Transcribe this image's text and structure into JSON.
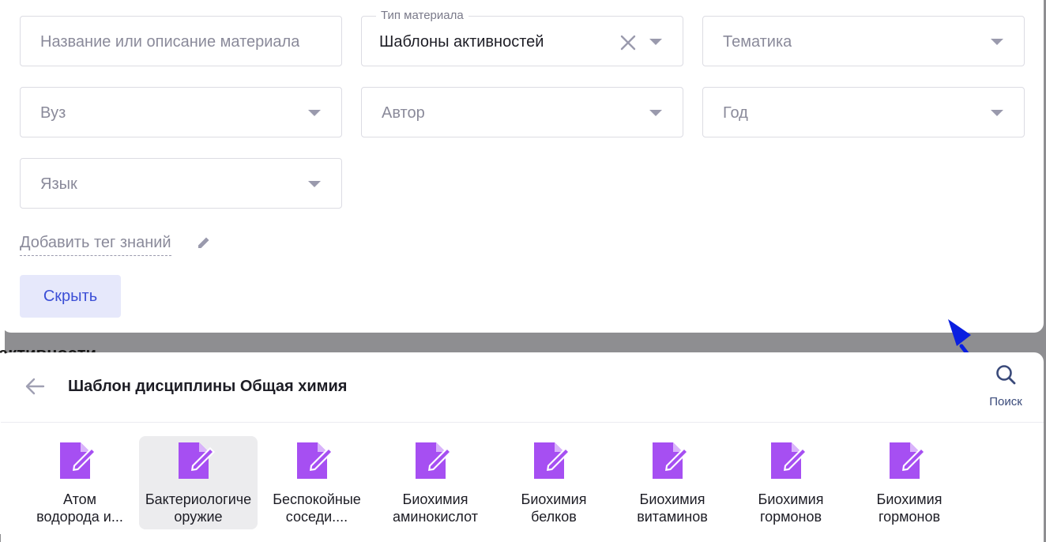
{
  "background": {
    "heading": "активности"
  },
  "filters": {
    "name_placeholder": "Название или описание материала",
    "material_type": {
      "label": "Тип материала",
      "value": "Шаблоны активностей"
    },
    "topic_placeholder": "Тематика",
    "university_placeholder": "Вуз",
    "author_placeholder": "Автор",
    "year_placeholder": "Год",
    "language_placeholder": "Язык",
    "add_tag_label": "Добавить тег знаний",
    "hide_button": "Скрыть"
  },
  "panel": {
    "title": "Шаблон дисциплины Общая химия",
    "search_label": "Поиск",
    "items": [
      {
        "name": "Атом\nводорода и..."
      },
      {
        "name": "Бактериологиче\nоружие",
        "selected": true
      },
      {
        "name": "Беспокойные\nсоседи...."
      },
      {
        "name": "Биохимия\nаминокислот"
      },
      {
        "name": "Биохимия\nбелков"
      },
      {
        "name": "Биохимия\nвитаминов"
      },
      {
        "name": "Биохимия\nгормонов"
      },
      {
        "name": "Биохимия\nгормонов"
      }
    ]
  },
  "colors": {
    "accent": "#3c4fd6",
    "item_icon": "#a64ff2",
    "annotation_arrow": "#0a1fe0"
  }
}
